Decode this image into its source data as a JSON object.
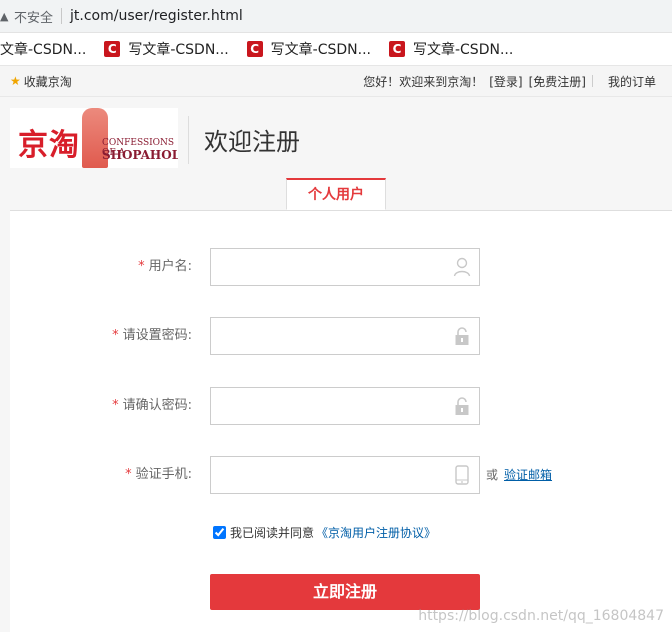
{
  "browser": {
    "security_label": "不安全",
    "url": "jt.com/user/register.html",
    "bookmarks": [
      {
        "label": "文章-CSDN..."
      },
      {
        "label": "写文章-CSDN..."
      },
      {
        "label": "写文章-CSDN..."
      },
      {
        "label": "写文章-CSDN..."
      }
    ]
  },
  "topbar": {
    "favorite": "收藏京淘",
    "welcome": "您好！欢迎来到京淘！",
    "login": "[登录]",
    "register": "[免费注册]",
    "orders": "我的订单"
  },
  "header": {
    "logo_text": "京淘",
    "logo_book_line1": "CONFESSIONS OF A",
    "logo_book_line2": "SHOPAHOLIC",
    "title": "欢迎注册"
  },
  "tabs": [
    {
      "label": "个人用户"
    }
  ],
  "form": {
    "required_mark": "*",
    "username_label": "用户名:",
    "password_label": "请设置密码:",
    "confirm_label": "请确认密码:",
    "phone_label": "验证手机:",
    "or_text": "或",
    "email_link": "验证邮箱",
    "agree_text": "我已阅读并同意",
    "agreement_link": "《京淘用户注册协议》",
    "submit_label": "立即注册",
    "colors": {
      "accent": "#e4393c",
      "link": "#005ea7"
    }
  },
  "watermark": "https://blog.csdn.net/qq_16804847"
}
